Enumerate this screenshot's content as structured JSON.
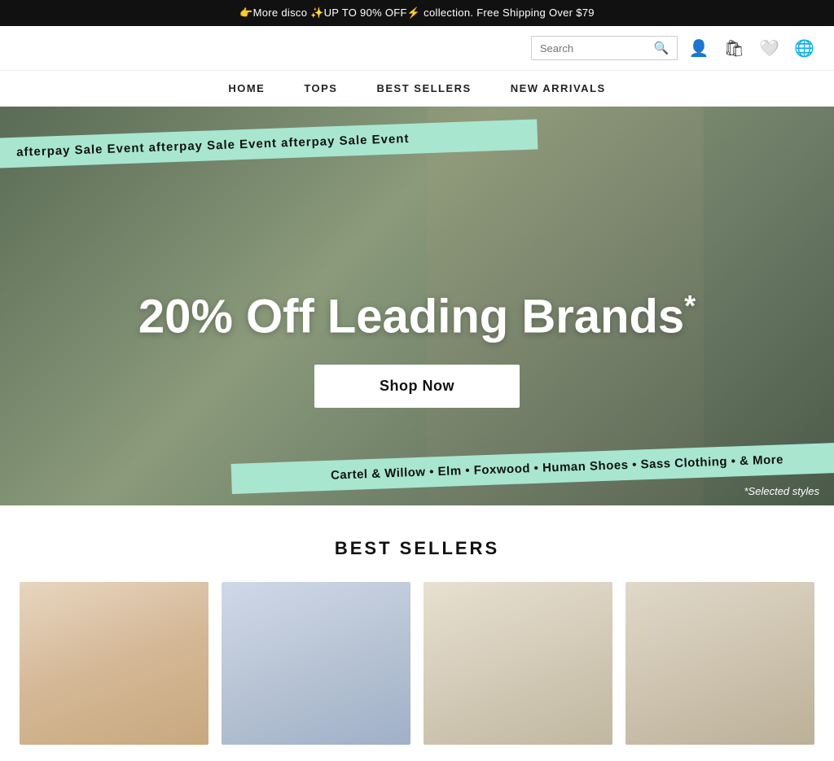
{
  "announcement": {
    "text": "👉More disco ✨UP TO 90% OFF⚡ collection.  Free Shipping Over $79"
  },
  "header": {
    "logo": "",
    "search_placeholder": "Search",
    "icons": {
      "search": "🔍",
      "account": "👤",
      "cart": "🛍",
      "wishlist": "🤍",
      "language": "🌐"
    }
  },
  "nav": {
    "items": [
      {
        "label": "HOME"
      },
      {
        "label": "TOPS"
      },
      {
        "label": "BEST SELLERS"
      },
      {
        "label": "NEW ARRIVALS"
      }
    ]
  },
  "hero": {
    "afterpay_text": "afterpay Sale Event   afterpay Sale Event   afterpay Sale Event",
    "headline": "20% Off Leading Brands",
    "asterisk": "*",
    "cta_label": "Shop Now",
    "brands_text": "Cartel & Willow • Elm • Foxwood • Human Shoes • Sass Clothing • & More",
    "selected_styles": "*Selected styles"
  },
  "best_sellers": {
    "title": "BEST SELLERS",
    "products": [
      {
        "id": 1
      },
      {
        "id": 2
      },
      {
        "id": 3
      },
      {
        "id": 4
      }
    ]
  }
}
